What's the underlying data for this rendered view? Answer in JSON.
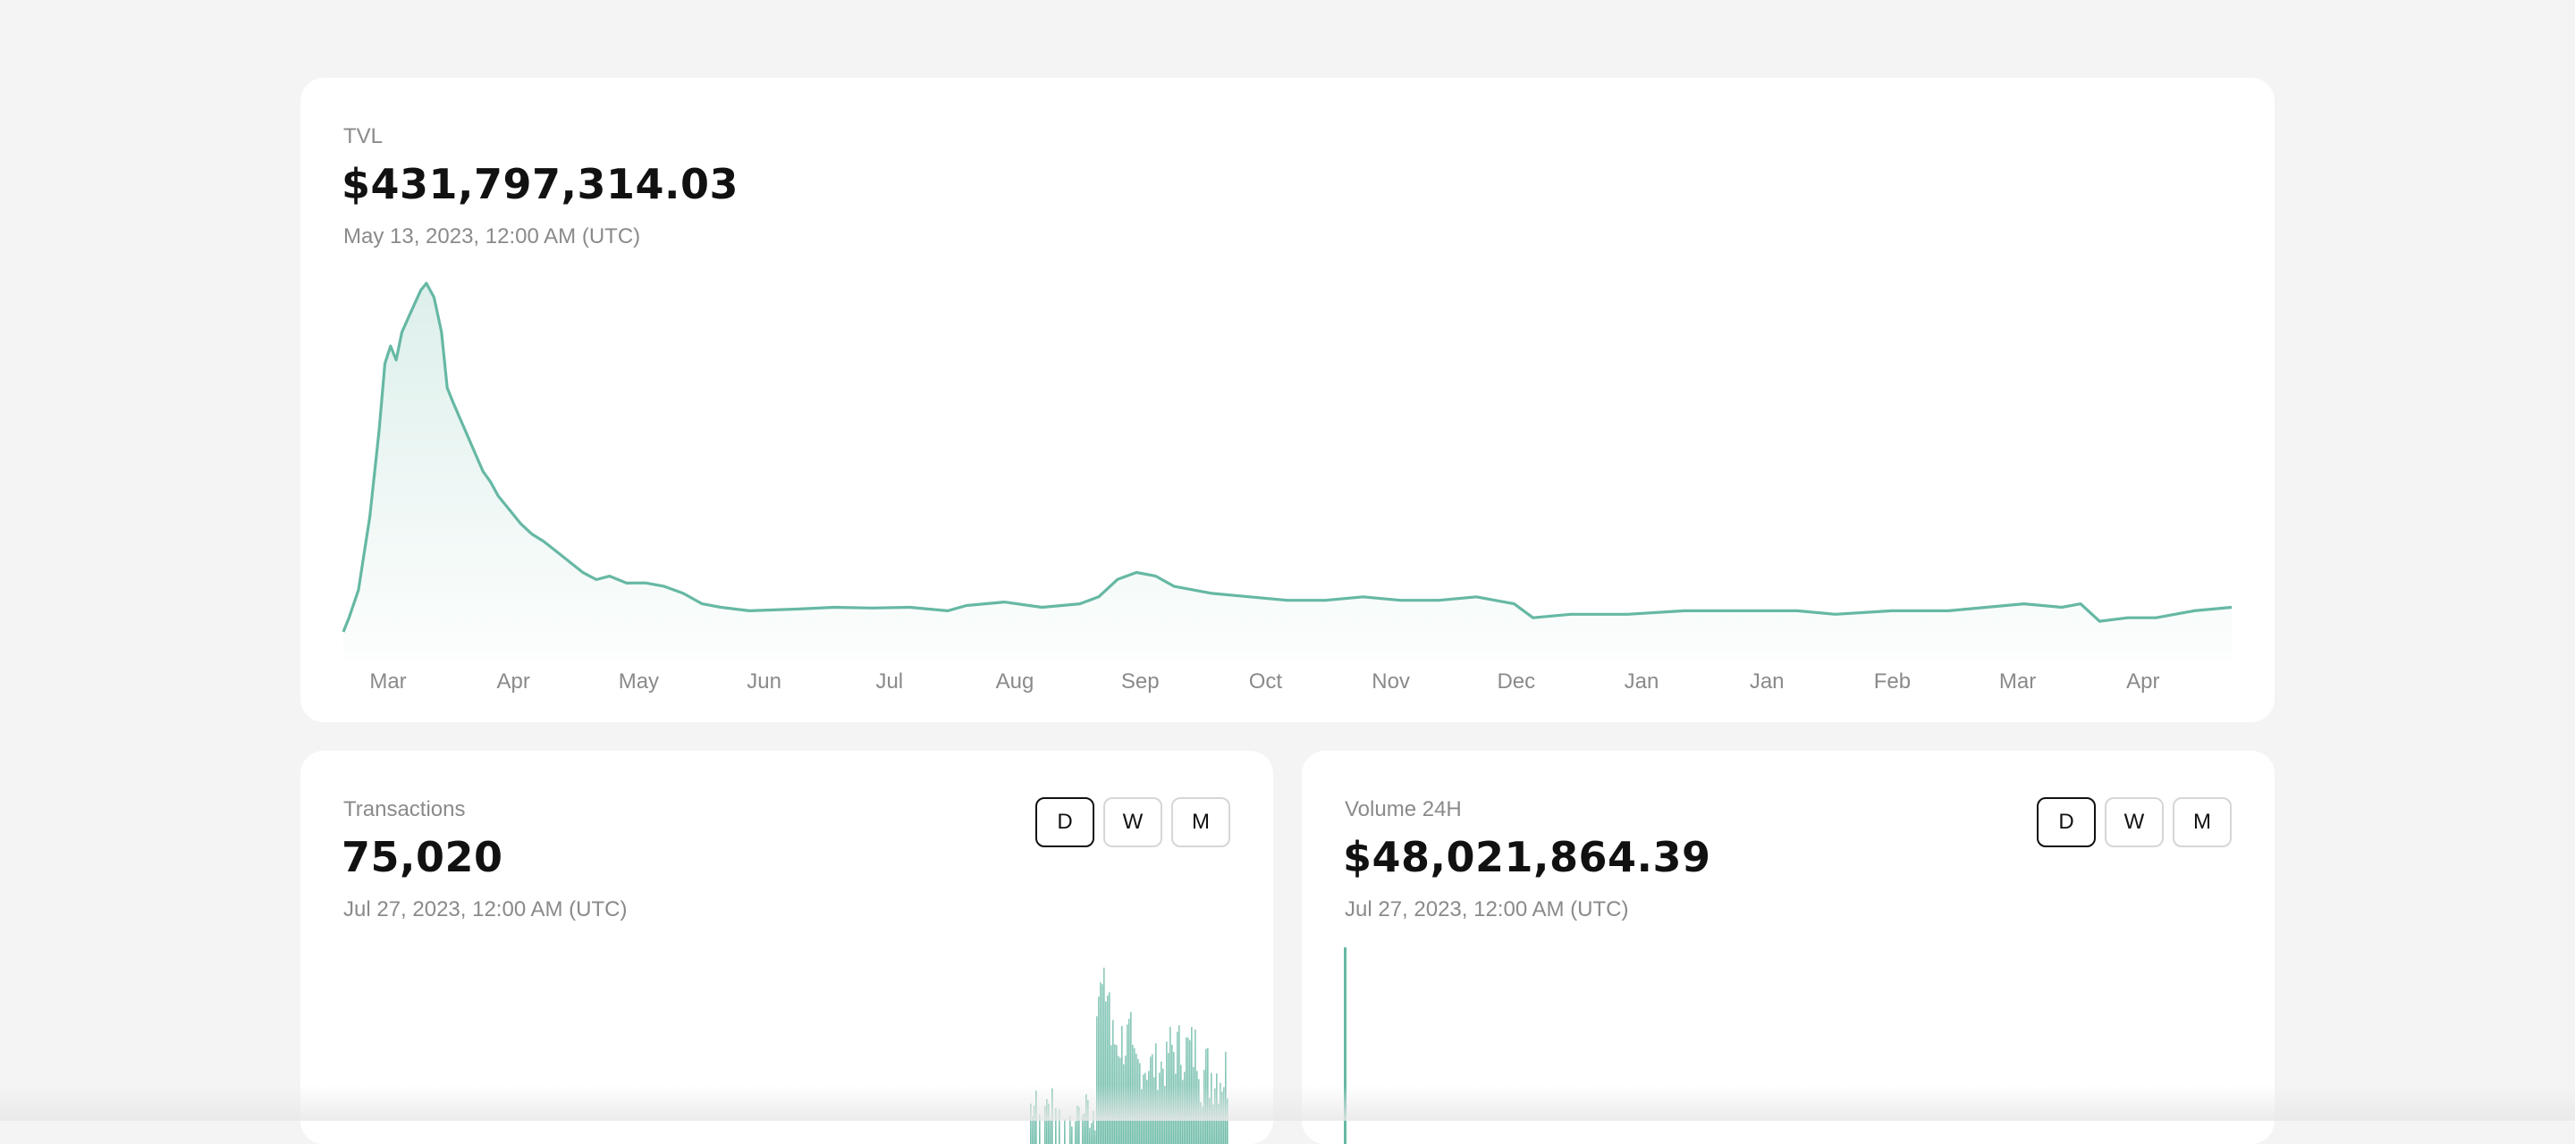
{
  "tvl": {
    "label": "TVL",
    "value": "$431,797,314.03",
    "date": "May 13, 2023, 12:00 AM (UTC)",
    "months": [
      "Mar",
      "Apr",
      "May",
      "Jun",
      "Jul",
      "Aug",
      "Sep",
      "Oct",
      "Nov",
      "Dec",
      "Jan",
      "Jan",
      "Feb",
      "Mar",
      "Apr"
    ]
  },
  "transactions": {
    "label": "Transactions",
    "value": "75,020",
    "date": "Jul 27, 2023, 12:00 AM (UTC)",
    "buttons": [
      "D",
      "W",
      "M"
    ],
    "active": "D"
  },
  "volume": {
    "label": "Volume 24H",
    "value": "$48,021,864.39",
    "date": "Jul 27, 2023, 12:00 AM (UTC)",
    "buttons": [
      "D",
      "W",
      "M"
    ],
    "active": "D"
  },
  "colors": {
    "accent": "#66b8a4",
    "fill": "#e6f4f0",
    "text": "#111111",
    "muted": "#8a8a8a"
  },
  "chart_data": [
    {
      "type": "area",
      "title": "TVL",
      "x": [
        "Mar",
        "Apr",
        "May",
        "Jun",
        "Jul",
        "Aug",
        "Sep",
        "Oct",
        "Nov",
        "Dec",
        "Jan",
        "Jan",
        "Feb",
        "Mar",
        "Apr"
      ],
      "values": [
        1.05,
        0.52,
        0.19,
        0.08,
        0.08,
        0.13,
        0.09,
        0.09,
        0.03,
        0.05,
        0.06,
        0.07,
        0.08,
        0.02,
        0.07
      ],
      "note_values_relative": "normalized 0-1 height of series",
      "grid": false
    },
    {
      "type": "bar",
      "title": "Transactions",
      "values_relative": "daily bars concentrated on the right portion"
    },
    {
      "type": "bar",
      "title": "Volume 24H",
      "values_relative": "single tall bar at left edge"
    }
  ]
}
